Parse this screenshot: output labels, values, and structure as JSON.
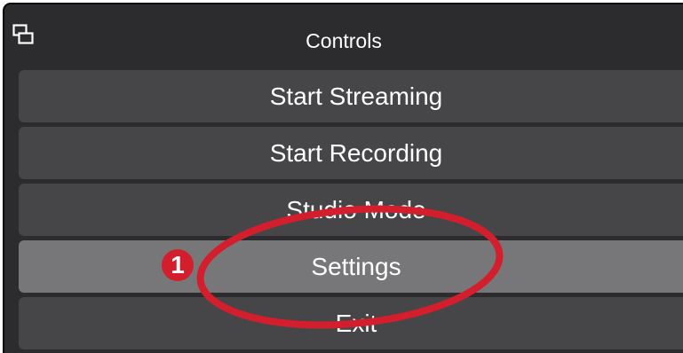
{
  "panel": {
    "title": "Controls",
    "undock_icon": "undock-icon"
  },
  "buttons": [
    {
      "label": "Start Streaming",
      "active": false
    },
    {
      "label": "Start Recording",
      "active": false
    },
    {
      "label": "Studio Mode",
      "active": false
    },
    {
      "label": "Settings",
      "active": true
    },
    {
      "label": "Exit",
      "active": false
    }
  ],
  "annotation": {
    "step_number": "1",
    "color": "#d31e2d"
  }
}
